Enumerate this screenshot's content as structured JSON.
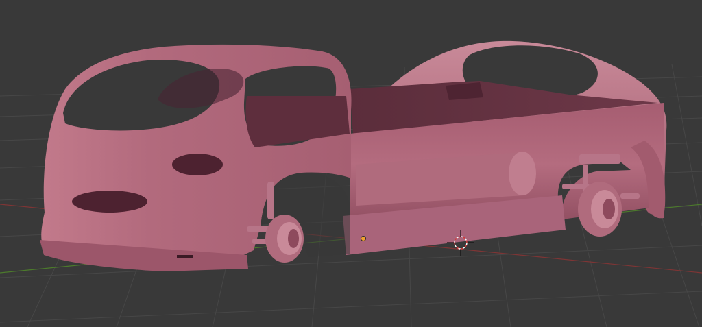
{
  "viewport": {
    "background": "#393939",
    "grid_color": "#4a4a4a",
    "x_axis_color": "#8a3a3a",
    "y_axis_color": "#4e7a2e",
    "model_color": "#b56a7c",
    "model_shadow_color": "#6e3848",
    "cursor_icon": "3d-cursor-icon",
    "origin_icon": "object-origin-icon",
    "origin_color": "#f0a030"
  }
}
